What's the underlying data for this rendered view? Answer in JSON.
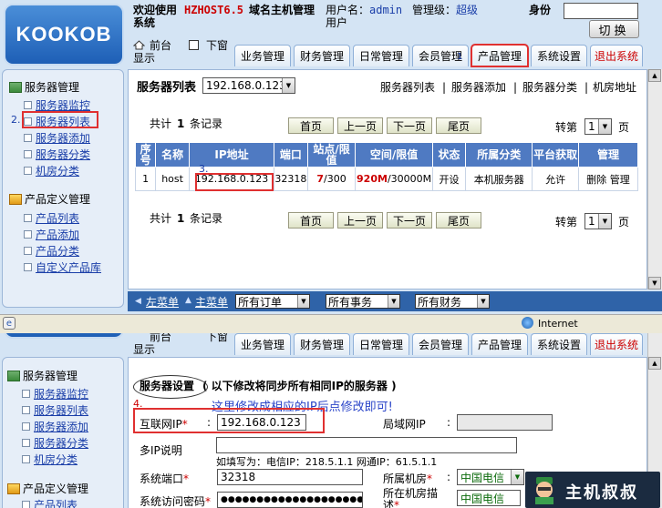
{
  "brand": {
    "logo_text": "KOOKOB"
  },
  "header": {
    "welcome": "欢迎使用",
    "product": "HZHOST6.5",
    "title_suffix": "域名主机管理",
    "title_line2": "系统",
    "username_label": "用户名：",
    "username_value": "admin",
    "user_line2": "用户",
    "level_label": "管理级：",
    "level_value": "超级",
    "identity_label": "身份",
    "switch_label": "切换",
    "front_label": "前台",
    "display_label": "显示",
    "new_window_label": "下窗"
  },
  "nav": {
    "tabs": [
      "业务管理",
      "财务管理",
      "日常管理",
      "会员管理",
      "产品管理",
      "系统设置",
      "退出系统"
    ],
    "marker_1": "1"
  },
  "sidebar": {
    "groups": [
      {
        "title": "服务器管理",
        "items": [
          "服务器监控",
          "服务器列表",
          "服务器添加",
          "服务器分类",
          "机房分类"
        ]
      },
      {
        "title": "产品定义管理",
        "items": [
          "产品列表",
          "产品添加",
          "产品分类",
          "自定义产品库"
        ]
      }
    ],
    "marker_2": "2."
  },
  "server_list": {
    "heading": "服务器列表",
    "ip_select": "192.168.0.123",
    "links": [
      "服务器列表",
      "服务器添加",
      "服务器分类",
      "机房地址"
    ],
    "separator": "|",
    "total_prefix": "共计",
    "total_count": "1",
    "total_suffix": "条记录",
    "pager": [
      "首页",
      "上一页",
      "下一页",
      "尾页"
    ],
    "goto_label": "转第",
    "goto_value": "1",
    "page_suffix": "页",
    "marker_3": "3.",
    "columns": [
      "序号",
      "名称",
      "IP地址",
      "端口",
      "站点/限值",
      "空间/限值",
      "状态",
      "所属分类",
      "平台获取",
      "管理"
    ],
    "rows": [
      {
        "no": "1",
        "name": "host",
        "ip": "192.168.0.123",
        "port": "32318",
        "sites_used": "7",
        "sites_limit": "/300",
        "space_used": "920M",
        "space_limit": "/30000M",
        "status": "开设",
        "category": "本机服务器",
        "platform": "允许",
        "actions": [
          "删除",
          "管理"
        ]
      }
    ]
  },
  "bottom_bar": {
    "left_menu": "左菜单",
    "main_menu": "主菜单",
    "dropdowns": [
      "所有订单",
      "所有事务",
      "所有财务"
    ]
  },
  "status_bar": {
    "zone": "Internet"
  },
  "edit_form": {
    "title": "服务器设置",
    "note": "( 以下修改将同步所有相同IP的服务器 )",
    "marker_4": "4.",
    "annotation": "这里修改成相应的IP后点修改即可!",
    "public_ip_label": "互联网IP",
    "public_ip_value": "192.168.0.123",
    "lan_ip_label": "局域网IP",
    "multi_ip_label": "多IP说明",
    "multi_ip_hint": "如填写为：电信IP：218.5.1.1 网通IP：61.5.1.1",
    "port_label": "系统端口",
    "port_value": "32318",
    "room_label": "所属机房",
    "room_value": "中国电信",
    "password_label": "系统访问密码",
    "password_mask": "●●●●●●●●●●●●●●●●●●●●●●●●",
    "room_desc_label": "所在机房描述",
    "room_desc_value": "中国电信",
    "required_mark": "*",
    "colon": ":"
  },
  "watermark": {
    "text": "主机叔叔"
  }
}
